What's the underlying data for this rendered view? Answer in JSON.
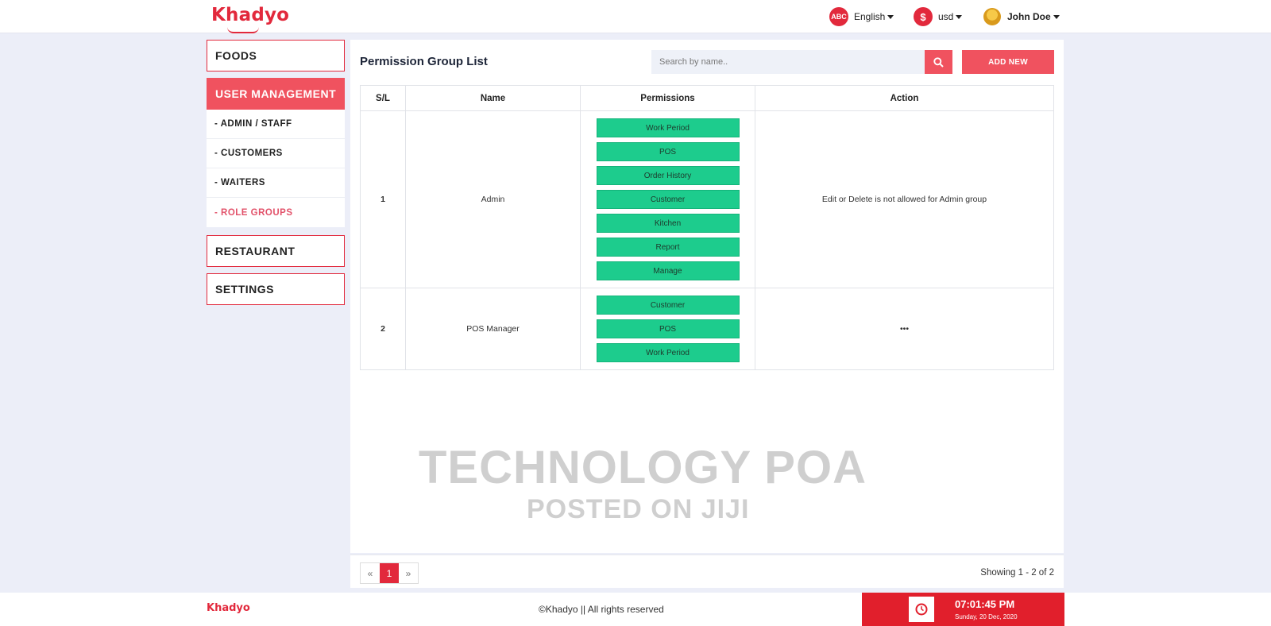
{
  "header": {
    "logo": "Khadyo",
    "language_icon": "ABC",
    "language": "English",
    "currency_icon": "$",
    "currency": "usd",
    "user": "John Doe"
  },
  "sidebar": {
    "foods": "FOODS",
    "user_management": "USER MANAGEMENT",
    "sub_items": [
      "- ADMIN / STAFF",
      "- CUSTOMERS",
      "- WAITERS",
      "- ROLE GROUPS"
    ],
    "restaurant": "RESTAURANT",
    "settings": "SETTINGS"
  },
  "main": {
    "title": "Permission Group List",
    "search_placeholder": "Search by name..",
    "add_new": "ADD NEW",
    "columns": [
      "S/L",
      "Name",
      "Permissions",
      "Action"
    ],
    "rows": [
      {
        "sl": "1",
        "name": "Admin",
        "permissions": [
          "Work Period",
          "POS",
          "Order History",
          "Customer",
          "Kitchen",
          "Report",
          "Manage"
        ],
        "action": "Edit or Delete is not allowed for Admin group"
      },
      {
        "sl": "2",
        "name": "POS Manager",
        "permissions": [
          "Customer",
          "POS",
          "Work Period"
        ],
        "action": "•••"
      }
    ],
    "watermark_line1": "TECHNOLOGY POA",
    "watermark_line2": "POSTED ON JIJI",
    "pager": {
      "prev": "«",
      "current": "1",
      "next": "»"
    },
    "showing": "Showing 1 - 2 of 2"
  },
  "footer": {
    "logo": "Khadyo",
    "copyright": "©Khadyo || All rights reserved",
    "time": "07:01:45 PM",
    "date": "Sunday, 20 Dec, 2020"
  },
  "colors": {
    "accent": "#e2293c",
    "accent_light": "#f0525f",
    "permission_green": "#1dcc8d",
    "background": "#eceef8"
  },
  "icons": {
    "search": "search-icon",
    "clock": "clock-icon",
    "caret": "chevron-down-icon",
    "avatar": "user-avatar"
  }
}
